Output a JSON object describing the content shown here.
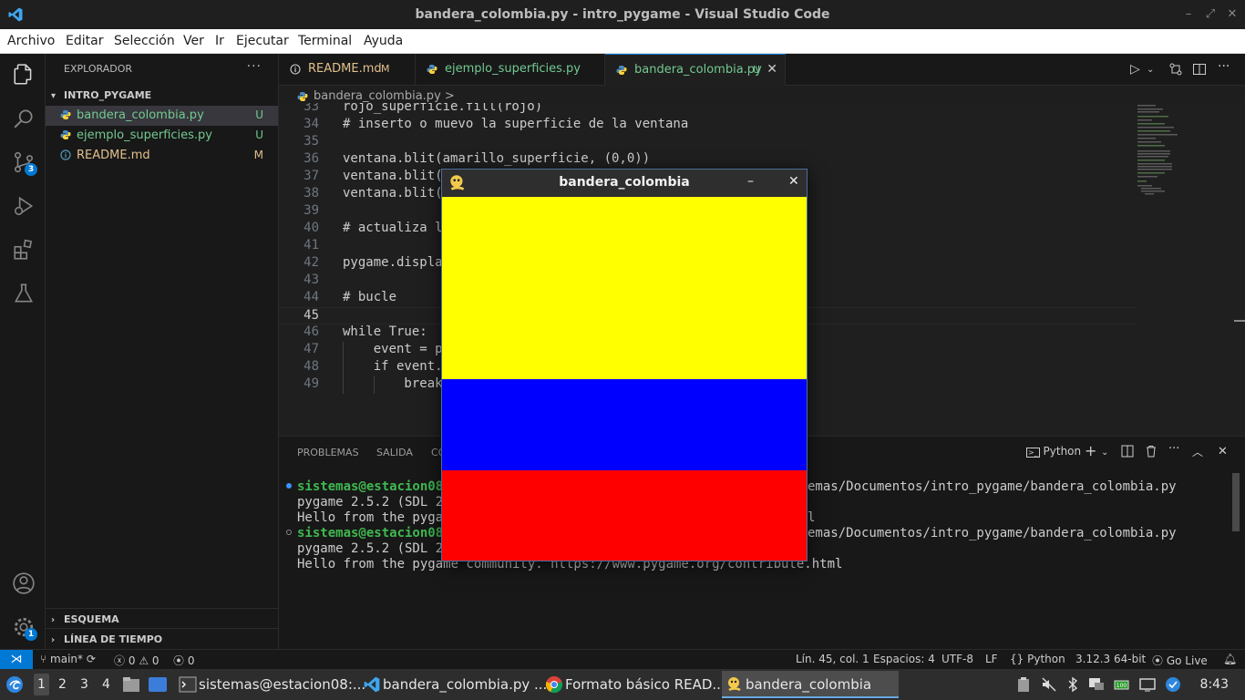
{
  "window": {
    "title": "bandera_colombia.py - intro_pygame - Visual Studio Code"
  },
  "menubar": [
    "Archivo",
    "Editar",
    "Selección",
    "Ver",
    "Ir",
    "Ejecutar",
    "Terminal",
    "Ayuda"
  ],
  "activity_bar": {
    "scm_badge": "3",
    "settings_badge": "1"
  },
  "sidebar": {
    "header": "EXPLORADOR",
    "more": "···",
    "project": "INTRO_PYGAME",
    "files": [
      {
        "name": "bandera_colombia.py",
        "status": "U"
      },
      {
        "name": "ejemplo_superficies.py",
        "status": "U"
      },
      {
        "name": "README.md",
        "status": "M"
      }
    ],
    "outline": "ESQUEMA",
    "timeline": "LÍNEA DE TIEMPO"
  },
  "tabs": [
    {
      "label": "README.md",
      "status": "M"
    },
    {
      "label": "ejemplo_superficies.py",
      "status": "U"
    },
    {
      "label": "bandera_colombia.py",
      "status": "U",
      "close": "✕"
    }
  ],
  "breadcrumb": "bandera_colombia.py >",
  "editor": {
    "lines": [
      {
        "n": "33",
        "text": "rojo_superficie.fill(rojo)"
      },
      {
        "n": "34",
        "text": "# inserto o muevo la superficie de la ventana"
      },
      {
        "n": "35",
        "text": ""
      },
      {
        "n": "36",
        "text": "ventana.blit(amarillo_superficie, (0,0))"
      },
      {
        "n": "37",
        "text": "ventana.blit("
      },
      {
        "n": "38",
        "text": "ventana.blit("
      },
      {
        "n": "39",
        "text": ""
      },
      {
        "n": "40",
        "text": "# actualiza l"
      },
      {
        "n": "41",
        "text": ""
      },
      {
        "n": "42",
        "text": "pygame.displa"
      },
      {
        "n": "43",
        "text": ""
      },
      {
        "n": "44",
        "text": "# bucle"
      },
      {
        "n": "45",
        "text": ""
      },
      {
        "n": "46",
        "text": "while True:"
      },
      {
        "n": "47",
        "text": "    event = p"
      },
      {
        "n": "48",
        "text": "    if event."
      },
      {
        "n": "49",
        "text": "        break"
      }
    ]
  },
  "panel": {
    "tabs": [
      "PROBLEMAS",
      "SALIDA",
      "CO"
    ],
    "shell": "Python",
    "terminal": [
      {
        "prompt": "sistemas@estacion08:",
        "rest": "emas/Documentos/intro_pygame/bandera_colombia.py"
      },
      {
        "text": "pygame 2.5.2 (SDL 2."
      },
      {
        "text": "Hello from the pygam",
        "rest": "l"
      },
      {
        "prompt": "sistemas@estacion08:",
        "rest": "emas/Documentos/intro_pygame/bandera_colombia.py"
      },
      {
        "text": "pygame 2.5.2 (SDL 2."
      },
      {
        "text": "Hello from the pygame community. https://www.pygame.org/contribute.html"
      }
    ]
  },
  "statusbar": {
    "branch": "main*",
    "errors": "0",
    "warnings": "0",
    "ports": "0",
    "position": "Lín. 45, col. 1",
    "spaces": "Espacios: 4",
    "encoding": "UTF-8",
    "eol": "LF",
    "language": "Python",
    "interpreter": "3.12.3 64-bit",
    "golive": "Go Live"
  },
  "taskbar": {
    "workspaces": [
      "1",
      "2",
      "3",
      "4"
    ],
    "items": [
      {
        "label": "sistemas@estacion08:..."
      },
      {
        "label": "bandera_colombia.py ..."
      },
      {
        "label": "Formato básico READ..."
      },
      {
        "label": "bandera_colombia"
      }
    ],
    "clock": "8:43"
  },
  "pygame_window": {
    "title": "bandera_colombia",
    "minimize": "–",
    "close": "✕",
    "stripes": [
      {
        "color": "#ffff00",
        "share": 0.5
      },
      {
        "color": "#0000ff",
        "share": 0.25
      },
      {
        "color": "#ff0000",
        "share": 0.25
      }
    ]
  },
  "colors": {
    "accent": "#0078d4",
    "untracked": "#73c991",
    "modified": "#e2c08d"
  }
}
